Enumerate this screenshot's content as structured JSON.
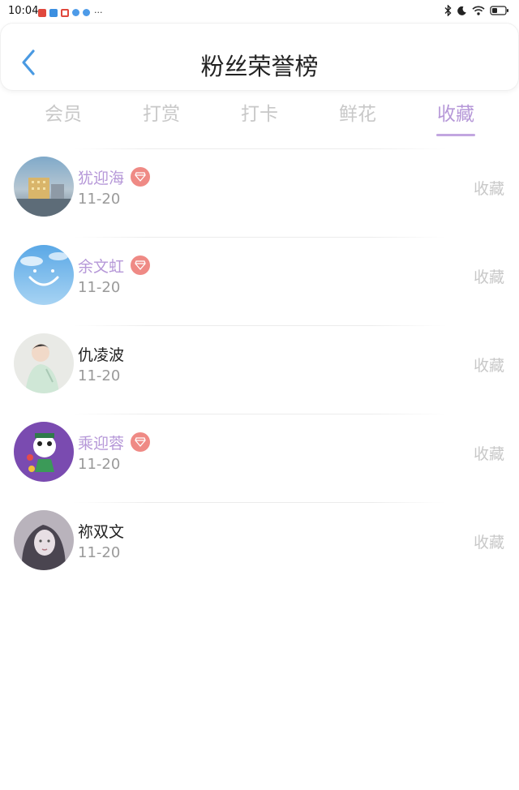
{
  "status_bar": {
    "time": "10:04",
    "overflow": "···",
    "battery_icon": "battery-icon",
    "wifi_icon": "wifi-icon"
  },
  "header": {
    "title": "粉丝荣誉榜",
    "back_icon": "back-chevron-icon"
  },
  "tabs": [
    {
      "label": "会员",
      "active": false
    },
    {
      "label": "打赏",
      "active": false
    },
    {
      "label": "打卡",
      "active": false
    },
    {
      "label": "鲜花",
      "active": false
    },
    {
      "label": "收藏",
      "active": true
    }
  ],
  "colors": {
    "accent": "#b698d8",
    "badge": "#ef8a85",
    "muted": "#c8c8c8",
    "date": "#9a9a9a"
  },
  "fans": [
    {
      "name": "犹迎海",
      "date": "11-20",
      "vip": true,
      "action": "收藏"
    },
    {
      "name": "余文虹",
      "date": "11-20",
      "vip": true,
      "action": "收藏"
    },
    {
      "name": "仇凌波",
      "date": "11-20",
      "vip": false,
      "action": "收藏"
    },
    {
      "name": "乘迎蓉",
      "date": "11-20",
      "vip": true,
      "action": "收藏"
    },
    {
      "name": "祢双文",
      "date": "11-20",
      "vip": false,
      "action": "收藏"
    }
  ]
}
